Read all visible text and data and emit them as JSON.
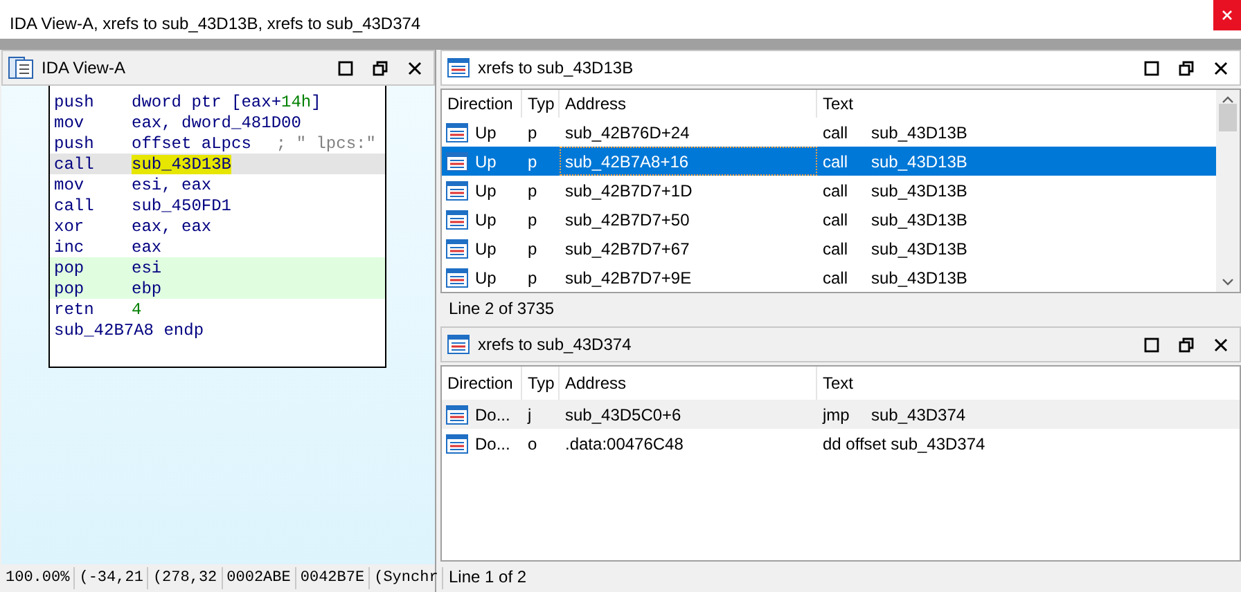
{
  "window": {
    "title": "IDA View-A, xrefs to sub_43D13B, xrefs to sub_43D374"
  },
  "ida_view": {
    "title": "IDA View-A",
    "lines": [
      {
        "kind": "instruction",
        "mnemonic": "push",
        "operands": [
          {
            "text": "dword ptr [eax+",
            "kind": "plain"
          },
          {
            "text": "14h",
            "kind": "number"
          },
          {
            "text": "]",
            "kind": "plain"
          }
        ],
        "selected": false,
        "highlighted": false
      },
      {
        "kind": "instruction",
        "mnemonic": "mov",
        "operands": [
          {
            "text": "eax, dword_481D00",
            "kind": "plain"
          }
        ],
        "selected": false,
        "highlighted": false
      },
      {
        "kind": "instruction",
        "mnemonic": "push",
        "operands": [
          {
            "text": "offset aLpcs",
            "kind": "plain"
          }
        ],
        "comment": "; \" lpcs:\"",
        "selected": false,
        "highlighted": false
      },
      {
        "kind": "instruction",
        "mnemonic": "call",
        "operands": [
          {
            "text": "sub_43D13B",
            "kind": "marked"
          }
        ],
        "selected": true,
        "highlighted": false
      },
      {
        "kind": "instruction",
        "mnemonic": "mov",
        "operands": [
          {
            "text": "esi, eax",
            "kind": "plain"
          }
        ],
        "selected": false,
        "highlighted": false
      },
      {
        "kind": "instruction",
        "mnemonic": "call",
        "operands": [
          {
            "text": "sub_450FD1",
            "kind": "plain"
          }
        ],
        "selected": false,
        "highlighted": false
      },
      {
        "kind": "instruction",
        "mnemonic": "xor",
        "operands": [
          {
            "text": "eax, eax",
            "kind": "plain"
          }
        ],
        "selected": false,
        "highlighted": false
      },
      {
        "kind": "instruction",
        "mnemonic": "inc",
        "operands": [
          {
            "text": "eax",
            "kind": "plain"
          }
        ],
        "selected": false,
        "highlighted": false
      },
      {
        "kind": "instruction",
        "mnemonic": "pop",
        "operands": [
          {
            "text": "esi",
            "kind": "plain"
          }
        ],
        "selected": false,
        "highlighted": true
      },
      {
        "kind": "instruction",
        "mnemonic": "pop",
        "operands": [
          {
            "text": "ebp",
            "kind": "plain"
          }
        ],
        "selected": false,
        "highlighted": true
      },
      {
        "kind": "instruction",
        "mnemonic": "retn",
        "operands": [
          {
            "text": "4",
            "kind": "number"
          }
        ],
        "selected": false,
        "highlighted": false
      },
      {
        "kind": "directive",
        "text": "sub_42B7A8 endp"
      }
    ],
    "status_bar": [
      "100.00%",
      "(-34,21",
      "(278,32",
      "0002ABE",
      "0042B7E",
      "(Synchr"
    ]
  },
  "xref_panels": [
    {
      "title": "xrefs to sub_43D13B",
      "focused": true,
      "scrollbar": true,
      "columns": [
        "Direction",
        "Typ",
        "Address",
        "Text"
      ],
      "rows": [
        {
          "direction": "Up",
          "type": "p",
          "address": "sub_42B76D+24",
          "text": "call",
          "target": "sub_43D13B",
          "selected": false
        },
        {
          "direction": "Up",
          "type": "p",
          "address": "sub_42B7A8+16",
          "text": "call",
          "target": "sub_43D13B",
          "selected": true
        },
        {
          "direction": "Up",
          "type": "p",
          "address": "sub_42B7D7+1D",
          "text": "call",
          "target": "sub_43D13B",
          "selected": false
        },
        {
          "direction": "Up",
          "type": "p",
          "address": "sub_42B7D7+50",
          "text": "call",
          "target": "sub_43D13B",
          "selected": false
        },
        {
          "direction": "Up",
          "type": "p",
          "address": "sub_42B7D7+67",
          "text": "call",
          "target": "sub_43D13B",
          "selected": false
        },
        {
          "direction": "Up",
          "type": "p",
          "address": "sub_42B7D7+9E",
          "text": "call",
          "target": "sub_43D13B",
          "selected": false
        }
      ],
      "status": "Line 2 of 3735"
    },
    {
      "title": "xrefs to sub_43D374",
      "focused": false,
      "scrollbar": false,
      "columns": [
        "Direction",
        "Typ",
        "Address",
        "Text"
      ],
      "rows": [
        {
          "direction": "Do...",
          "type": "j",
          "address": "sub_43D5C0+6",
          "text": "jmp",
          "target": "sub_43D374",
          "selected": true
        },
        {
          "direction": "Do...",
          "type": "o",
          "address": ".data:00476C48",
          "text": "dd offset sub_43D374",
          "selected": false
        }
      ],
      "status": "Line 1 of 2"
    }
  ]
}
